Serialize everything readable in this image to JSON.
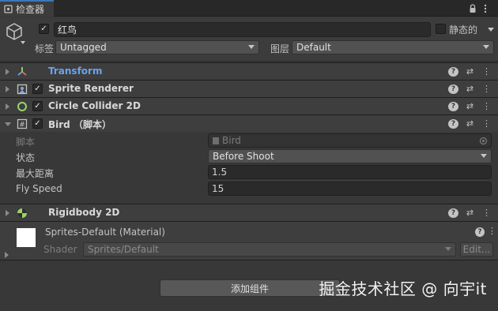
{
  "tab": {
    "title": "检查器",
    "lock_icon": "lock-icon",
    "menu_icon": "kebab-menu-icon"
  },
  "object": {
    "name": "红鸟",
    "active": true,
    "static_label": "静态的",
    "static": false,
    "tag_label": "标签",
    "tag_value": "Untagged",
    "layer_label": "图层",
    "layer_value": "Default"
  },
  "components": {
    "transform": {
      "title": "Transform",
      "color": "#6ba4e7"
    },
    "sprite_renderer": {
      "title": "Sprite Renderer",
      "enabled": true
    },
    "circle_collider": {
      "title": "Circle Collider 2D",
      "enabled": true
    },
    "bird": {
      "title": "Bird （脚本）",
      "enabled": true
    },
    "rigidbody": {
      "title": "Rigidbody 2D"
    }
  },
  "bird_props": {
    "script_label": "脚本",
    "script_value": "Bird",
    "state_label": "状态",
    "state_value": "Before Shoot",
    "max_distance_label": "最大距离",
    "max_distance_value": "1.5",
    "fly_speed_label": "Fly Speed",
    "fly_speed_value": "15"
  },
  "material": {
    "title": "Sprites-Default (Material)",
    "shader_label": "Shader",
    "shader_value": "Sprites/Default",
    "edit_label": "Edit..."
  },
  "add_component_label": "添加组件",
  "watermark": "掘金技术社区 @ 向宇it"
}
